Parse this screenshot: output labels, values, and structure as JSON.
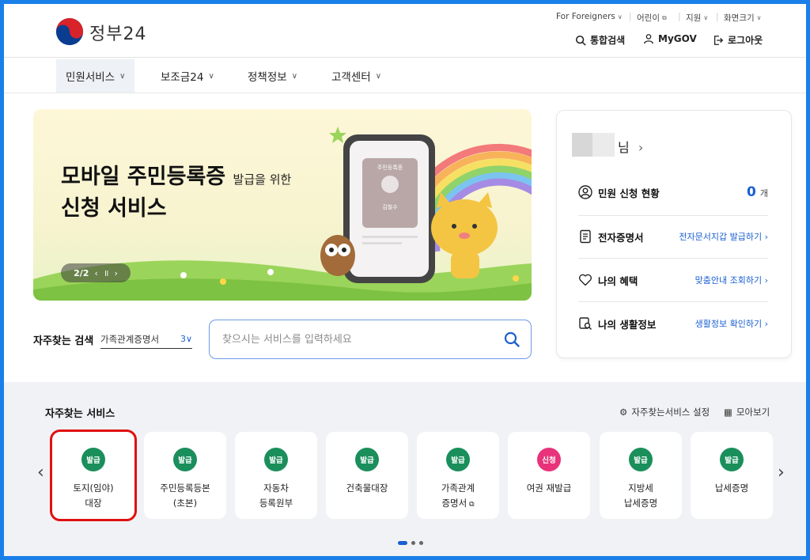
{
  "header": {
    "logo_text": "정부24",
    "util_links": [
      {
        "label": "For Foreigners"
      },
      {
        "label": "어린이"
      },
      {
        "label": "지원"
      },
      {
        "label": "화면크기"
      }
    ],
    "actions": {
      "search": "통합검색",
      "mygov": "MyGOV",
      "logout": "로그아웃"
    }
  },
  "nav": {
    "items": [
      "민원서비스",
      "보조금24",
      "정책정보",
      "고객센터"
    ]
  },
  "banner": {
    "title_main": "모바일 주민등록증",
    "title_small": "발급을 위한",
    "title_line2": "신청 서비스",
    "pager": "2/2",
    "card_label": "주민등록증",
    "card_name": "김철수"
  },
  "search": {
    "label": "자주찾는 검색",
    "select_value": "가족관계증명서",
    "select_count": "3",
    "placeholder": "찾으시는 서비스를 입력하세요"
  },
  "panel": {
    "user_suffix": "님",
    "rows": [
      {
        "label": "민원 신청 현황",
        "count": "0",
        "unit": "개"
      },
      {
        "label": "전자증명서",
        "link": "전자문서지갑 발급하기"
      },
      {
        "label": "나의 혜택",
        "link": "맞춤안내 조회하기"
      },
      {
        "label": "나의 생활정보",
        "link": "생활정보 확인하기"
      }
    ]
  },
  "favorites": {
    "title": "자주찾는 서비스",
    "settings_label": "자주찾는서비스 설정",
    "view_all_label": "모아보기",
    "cards": [
      {
        "badge": "발급",
        "line1": "토지(임야)",
        "line2": "대장",
        "badge_color": "#1a8f5c"
      },
      {
        "badge": "발급",
        "line1": "주민등록등본",
        "line2": "(초본)",
        "badge_color": "#1a8f5c"
      },
      {
        "badge": "발급",
        "line1": "자동차",
        "line2": "등록원부",
        "badge_color": "#1a8f5c"
      },
      {
        "badge": "발급",
        "line1": "건축물대장",
        "line2": "",
        "badge_color": "#1a8f5c"
      },
      {
        "badge": "발급",
        "line1": "가족관계",
        "line2": "증명서",
        "badge_color": "#1a8f5c"
      },
      {
        "badge": "신청",
        "line1": "여권 재발급",
        "line2": "",
        "badge_color": "#e8337a"
      },
      {
        "badge": "발급",
        "line1": "지방세",
        "line2": "납세증명",
        "badge_color": "#1a8f5c"
      },
      {
        "badge": "발급",
        "line1": "납세증명",
        "line2": "",
        "badge_color": "#1a8f5c"
      }
    ]
  },
  "colors": {
    "frame_border": "#1a7fe8",
    "accent_blue": "#1a5fd1",
    "issue_badge": "#1a8f5c",
    "apply_badge": "#e8337a",
    "selected_outline": "#e01010"
  }
}
